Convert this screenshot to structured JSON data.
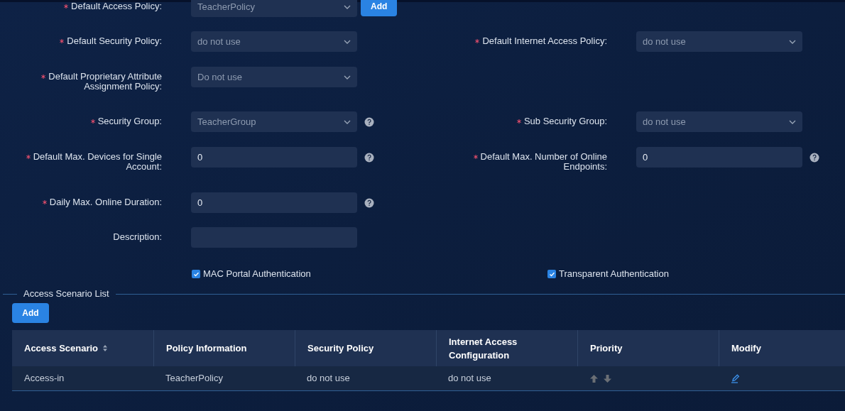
{
  "form": {
    "rows": [
      {
        "left": {
          "label": "Default Access Policy:",
          "required": true,
          "kind": "select",
          "value": "TeacherPolicy",
          "help": false,
          "add_button": "Add"
        }
      },
      {
        "left": {
          "label": "Default Security Policy:",
          "required": true,
          "kind": "select",
          "value": "do not use",
          "help": false
        },
        "right": {
          "label": "Default Internet Access Policy:",
          "required": true,
          "kind": "select",
          "value": "do not use",
          "help": false
        }
      },
      {
        "left": {
          "label": "Default Proprietary Attribute Assignment Policy:",
          "required": true,
          "kind": "select",
          "value": "Do not use",
          "help": false
        }
      },
      {
        "left": {
          "label": "Security Group:",
          "required": true,
          "kind": "select",
          "value": "TeacherGroup",
          "help": true
        },
        "right": {
          "label": "Sub Security Group:",
          "required": true,
          "kind": "select",
          "value": "do not use",
          "help": false
        }
      },
      {
        "left": {
          "label": "Default Max. Devices for Single Account:",
          "required": true,
          "kind": "input",
          "value": "0",
          "help": true
        },
        "right": {
          "label": "Default Max. Number of Online Endpoints:",
          "required": true,
          "kind": "input",
          "value": "0",
          "help": true
        }
      },
      {
        "left": {
          "label": "Daily Max. Online Duration:",
          "required": true,
          "kind": "input",
          "value": "0",
          "help": true
        }
      },
      {
        "left": {
          "label": "Description:",
          "required": false,
          "kind": "input",
          "help": false
        }
      }
    ],
    "checkboxes": [
      {
        "label": "MAC Portal Authentication",
        "checked": true
      },
      {
        "label": "Transparent Authentication",
        "checked": true
      }
    ]
  },
  "scenario_section": {
    "title": "Access Scenario List",
    "add_button": "Add",
    "table": {
      "columns": [
        {
          "label": "Access Scenario",
          "sortable": true
        },
        {
          "label": "Policy Information",
          "sortable": false
        },
        {
          "label": "Security Policy",
          "sortable": false
        },
        {
          "label": "Internet Access Configuration",
          "sortable": false
        },
        {
          "label": "Priority",
          "sortable": false
        },
        {
          "label": "Modify",
          "sortable": false
        }
      ],
      "rows": [
        [
          "Access-in",
          "TeacherPolicy",
          "do not use",
          "do not use",
          {
            "kind": "priority"
          },
          {
            "kind": "edit"
          }
        ]
      ]
    }
  }
}
